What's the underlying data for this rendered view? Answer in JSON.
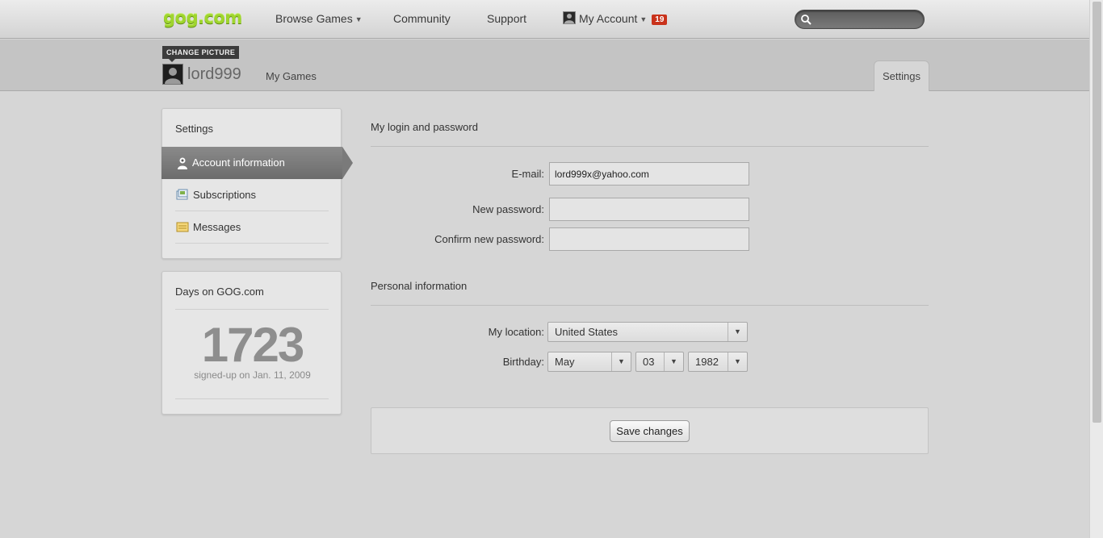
{
  "header": {
    "logo": "gog.com",
    "nav": {
      "browse_games": "Browse Games",
      "community": "Community",
      "support": "Support",
      "my_account": "My Account",
      "notification_count": "19"
    },
    "search": {
      "placeholder": "",
      "value": ""
    }
  },
  "profile": {
    "change_picture": "CHANGE PICTURE",
    "username": "lord999",
    "my_games": "My Games",
    "settings_tab": "Settings"
  },
  "sidebar": {
    "settings_title": "Settings",
    "items": [
      {
        "label": "Account information",
        "icon": "account-icon",
        "active": true
      },
      {
        "label": "Subscriptions",
        "icon": "subscriptions-icon",
        "active": false
      },
      {
        "label": "Messages",
        "icon": "messages-icon",
        "active": false
      }
    ],
    "days": {
      "title": "Days on GOG.com",
      "count": "1723",
      "signed_up": "signed-up on Jan. 11, 2009"
    }
  },
  "form": {
    "login_section": "My login and password",
    "email_label": "E-mail:",
    "email_value": "lord999x@yahoo.com",
    "new_password_label": "New password:",
    "confirm_password_label": "Confirm new password:",
    "personal_section": "Personal information",
    "location_label": "My location:",
    "location_value": "United States",
    "birthday_label": "Birthday:",
    "birth_month": "May",
    "birth_day": "03",
    "birth_year": "1982",
    "save_button": "Save changes"
  },
  "colors": {
    "logo_green": "#9fd52e",
    "badge_red": "#c9321b",
    "active_menu": "#7a7a7a",
    "page_bg": "#d6d6d6"
  }
}
